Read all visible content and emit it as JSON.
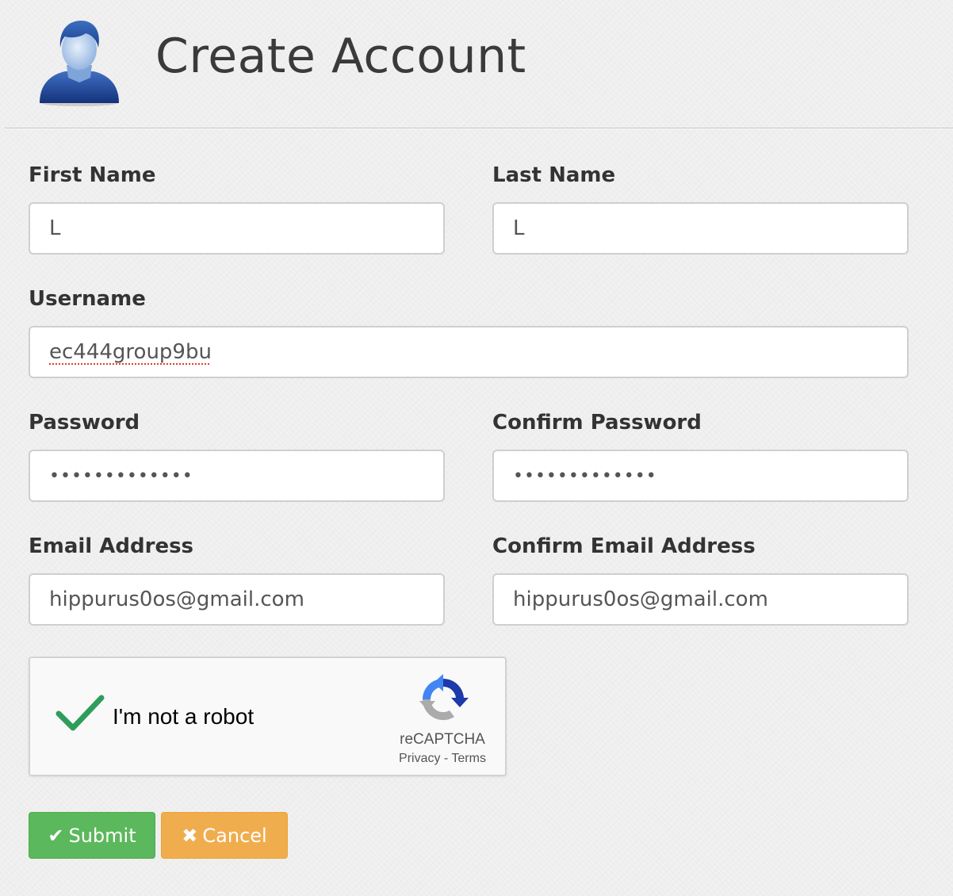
{
  "header": {
    "title": "Create Account",
    "avatar_icon": "user-avatar-icon"
  },
  "form": {
    "first_name": {
      "label": "First Name",
      "value": "L"
    },
    "last_name": {
      "label": "Last Name",
      "value": "L"
    },
    "username": {
      "label": "Username",
      "value": "ec444group9bu"
    },
    "password": {
      "label": "Password",
      "value": "•••••••••••••"
    },
    "confirm_password": {
      "label": "Confirm Password",
      "value": "•••••••••••••"
    },
    "email": {
      "label": "Email Address",
      "value": "hippurus0os@gmail.com"
    },
    "confirm_email": {
      "label": "Confirm Email Address",
      "value": "hippurus0os@gmail.com"
    }
  },
  "captcha": {
    "label": "I'm not a robot",
    "brand": "reCAPTCHA",
    "privacy": "Privacy",
    "separator": " - ",
    "terms": "Terms",
    "checked": true,
    "check_color": "#2e9d5b"
  },
  "buttons": {
    "submit": {
      "label": "Submit",
      "icon": "checkmark-icon",
      "color": "#5cb85c"
    },
    "cancel": {
      "label": "Cancel",
      "icon": "x-icon",
      "color": "#f0ad4e"
    }
  }
}
